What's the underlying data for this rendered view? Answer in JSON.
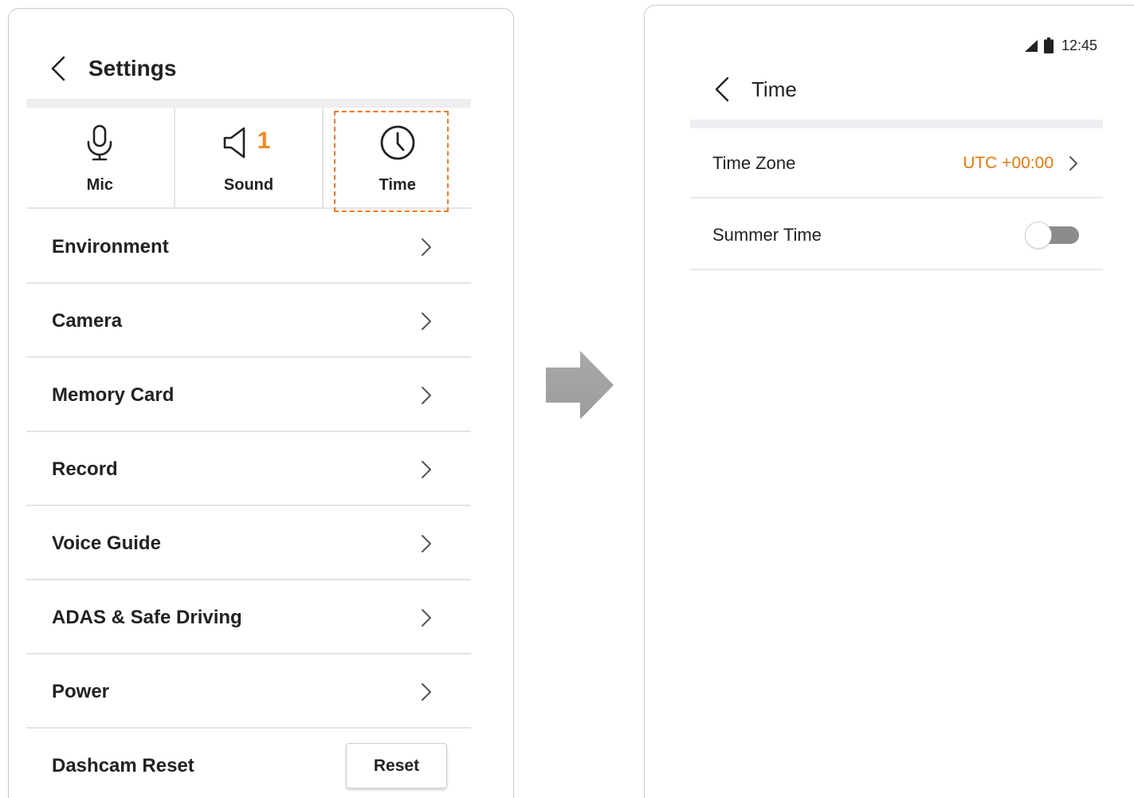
{
  "settings_screen": {
    "title": "Settings",
    "quick_settings": [
      {
        "label": "Mic",
        "icon": "mic-icon"
      },
      {
        "label": "Sound",
        "icon": "speaker-icon",
        "badge": "1"
      },
      {
        "label": "Time",
        "icon": "clock-icon",
        "highlighted": true
      }
    ],
    "menu_items": [
      {
        "label": "Environment"
      },
      {
        "label": "Camera"
      },
      {
        "label": "Memory Card"
      },
      {
        "label": "Record"
      },
      {
        "label": "Voice Guide"
      },
      {
        "label": "ADAS & Safe Driving"
      },
      {
        "label": "Power"
      }
    ],
    "reset_row": {
      "label": "Dashcam Reset",
      "button_label": "Reset"
    }
  },
  "time_screen": {
    "status_time": "12:45",
    "title": "Time",
    "time_zone": {
      "label": "Time Zone",
      "value": "UTC +00:00"
    },
    "summer_time": {
      "label": "Summer Time",
      "enabled": false
    }
  },
  "colors": {
    "accent_orange": "#f07a22",
    "value_orange": "#e07a10",
    "arrow_gray": "#a3a3a3",
    "divider": "#e4e4e6"
  }
}
